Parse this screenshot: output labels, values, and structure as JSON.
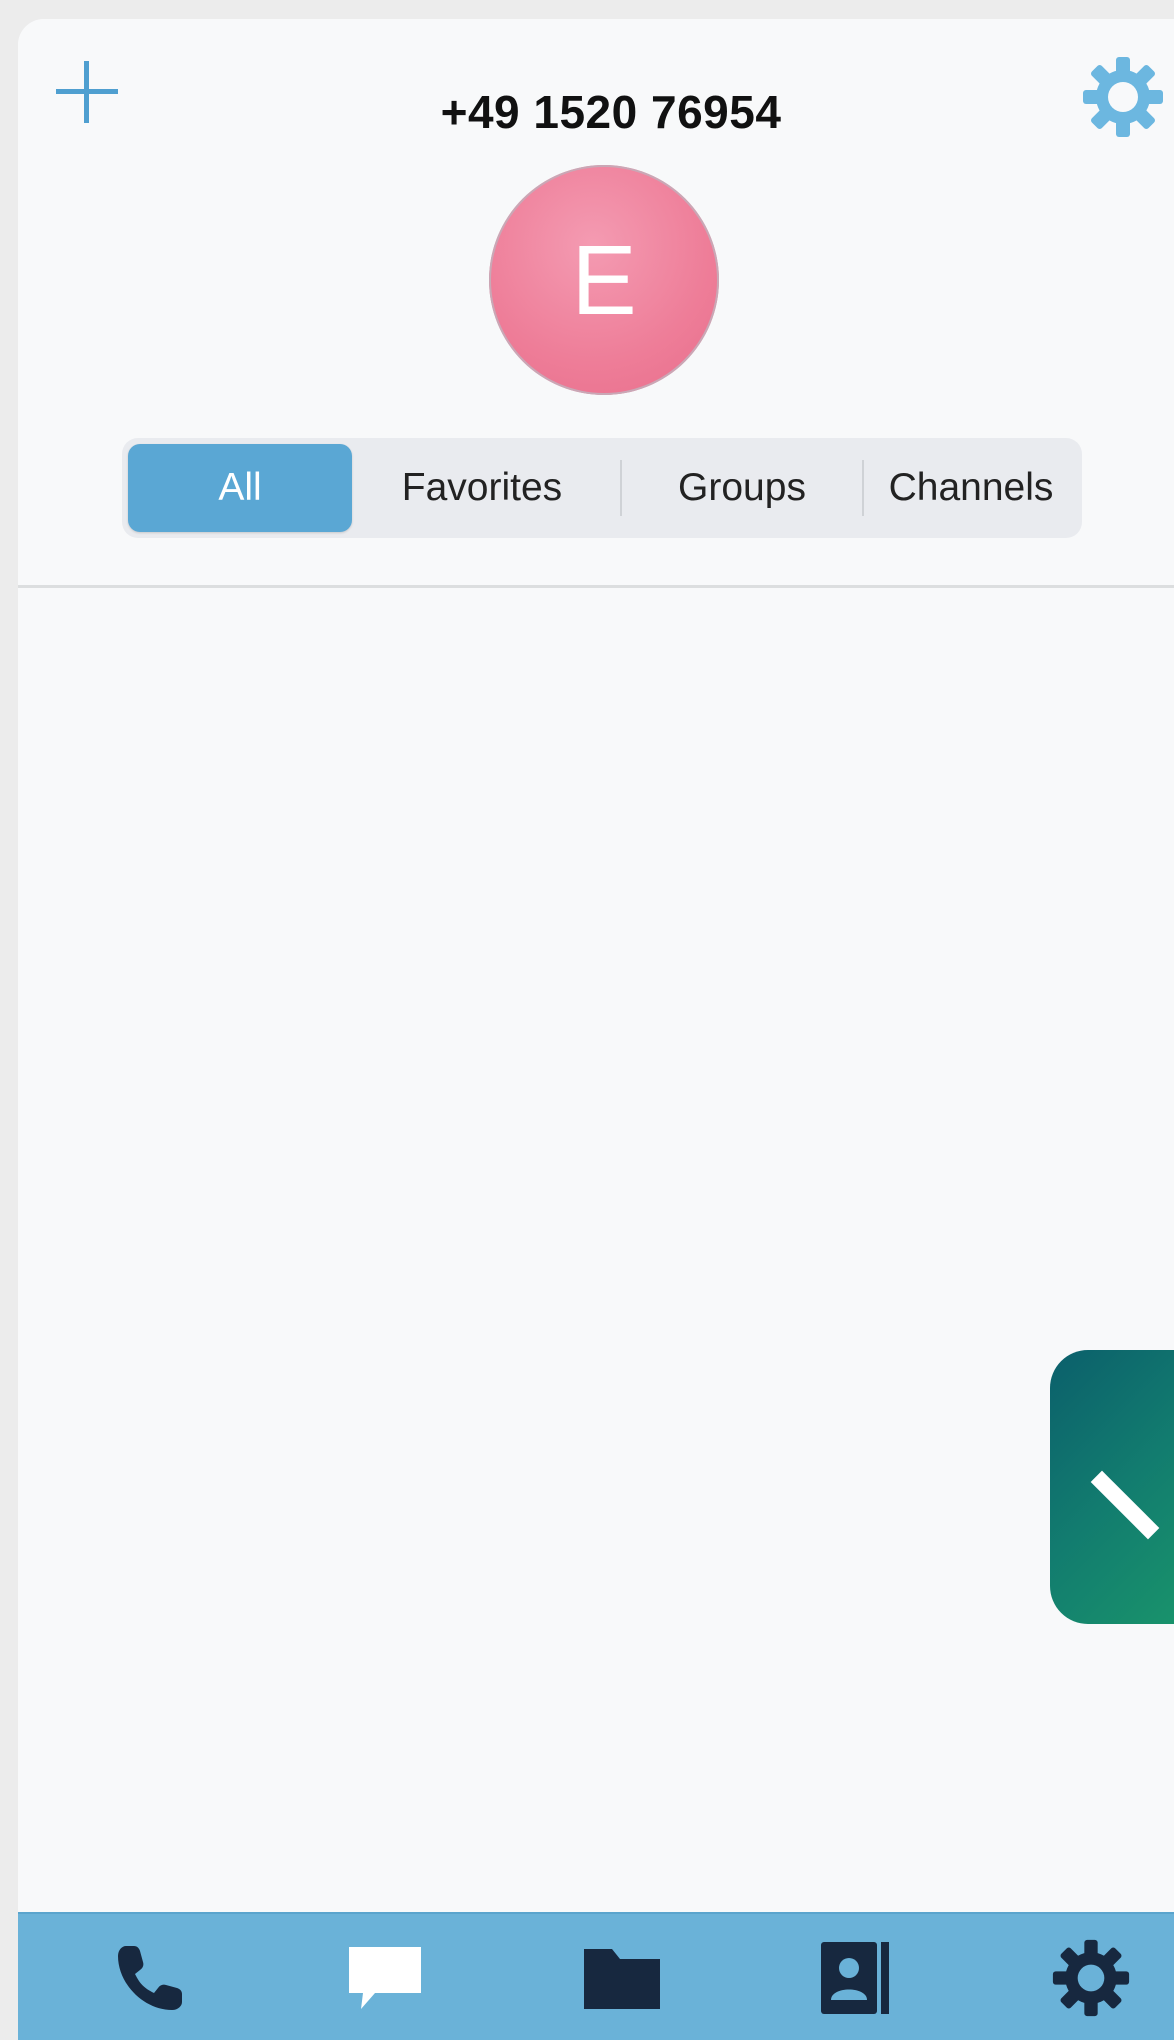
{
  "header": {
    "title": "+49 1520 76954",
    "add_icon": "plus-icon",
    "settings_icon": "gear-icon",
    "avatar_initial": "E",
    "avatar_color": "#ee7d98"
  },
  "filter_tabs": {
    "items": [
      {
        "label": "All",
        "selected": true
      },
      {
        "label": "Favorites",
        "selected": false
      },
      {
        "label": "Groups",
        "selected": false
      },
      {
        "label": "Channels",
        "selected": false
      }
    ],
    "accent": "#5aa7d4"
  },
  "fab": {
    "icon": "checkmark-icon",
    "color": "#127c6f"
  },
  "tab_bar": {
    "background": "#6ab2d8",
    "items": [
      {
        "icon": "phone-icon"
      },
      {
        "icon": "chat-bubble-icon"
      },
      {
        "icon": "folder-icon"
      },
      {
        "icon": "contacts-book-icon"
      },
      {
        "icon": "gear-icon"
      }
    ]
  }
}
